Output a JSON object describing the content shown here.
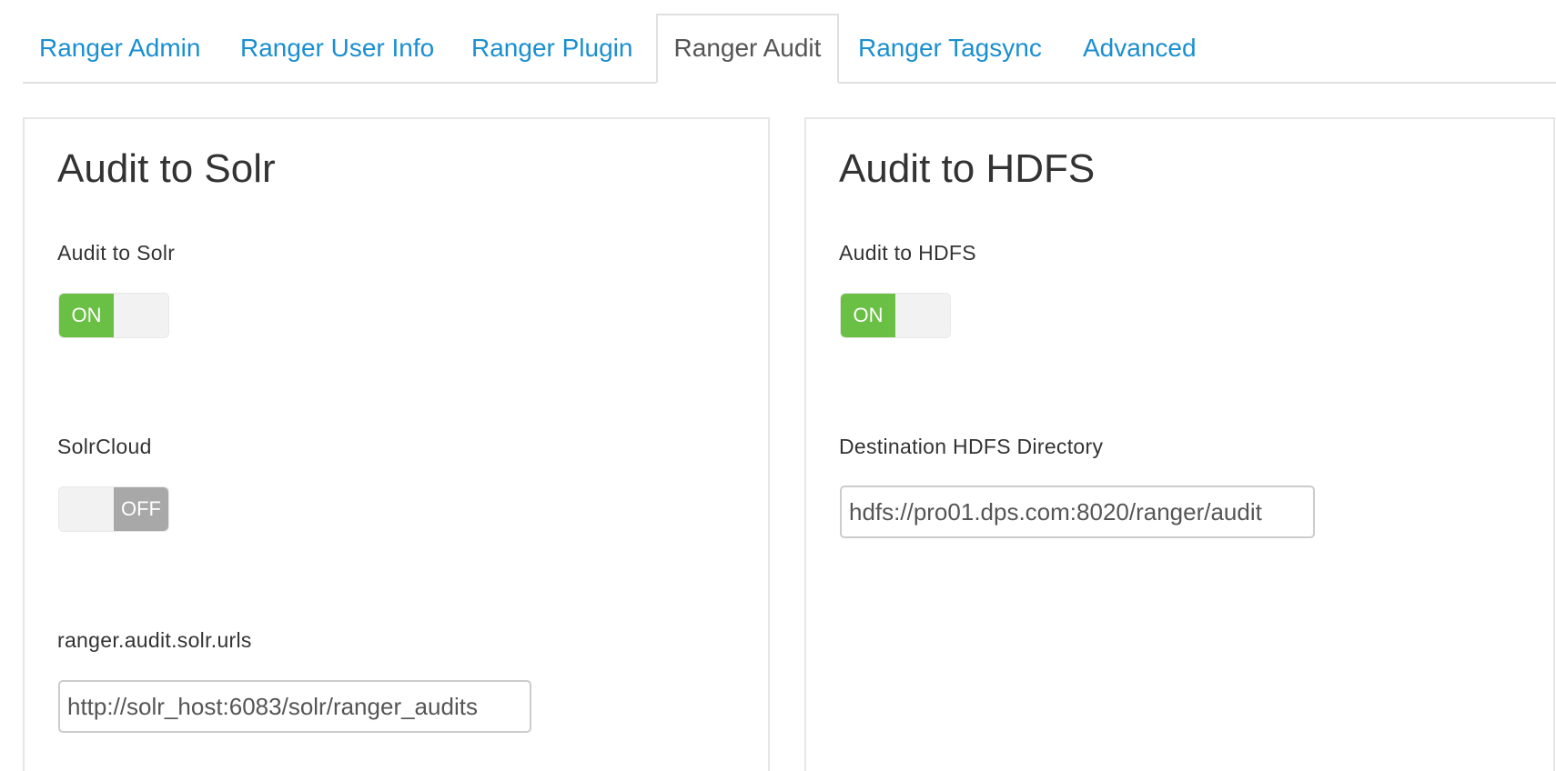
{
  "tabs": [
    {
      "label": "Ranger Admin",
      "active": false
    },
    {
      "label": "Ranger User Info",
      "active": false
    },
    {
      "label": "Ranger Plugin",
      "active": false
    },
    {
      "label": "Ranger Audit",
      "active": true
    },
    {
      "label": "Ranger Tagsync",
      "active": false
    },
    {
      "label": "Advanced",
      "active": false
    }
  ],
  "solr_panel": {
    "title": "Audit to Solr",
    "audit_to_solr": {
      "label": "Audit to Solr",
      "state": "ON"
    },
    "solr_cloud": {
      "label": "SolrCloud",
      "state": "OFF"
    },
    "solr_urls": {
      "label": "ranger.audit.solr.urls",
      "value": "http://solr_host:6083/solr/ranger_audits"
    }
  },
  "hdfs_panel": {
    "title": "Audit to HDFS",
    "audit_to_hdfs": {
      "label": "Audit to HDFS",
      "state": "ON"
    },
    "destination_dir": {
      "label": "Destination HDFS Directory",
      "value": "hdfs://pro01.dps.com:8020/ranger/audit"
    }
  },
  "colors": {
    "link": "#1a8fd0",
    "toggle_on": "#6abf45",
    "toggle_off": "#a8a8a8"
  }
}
